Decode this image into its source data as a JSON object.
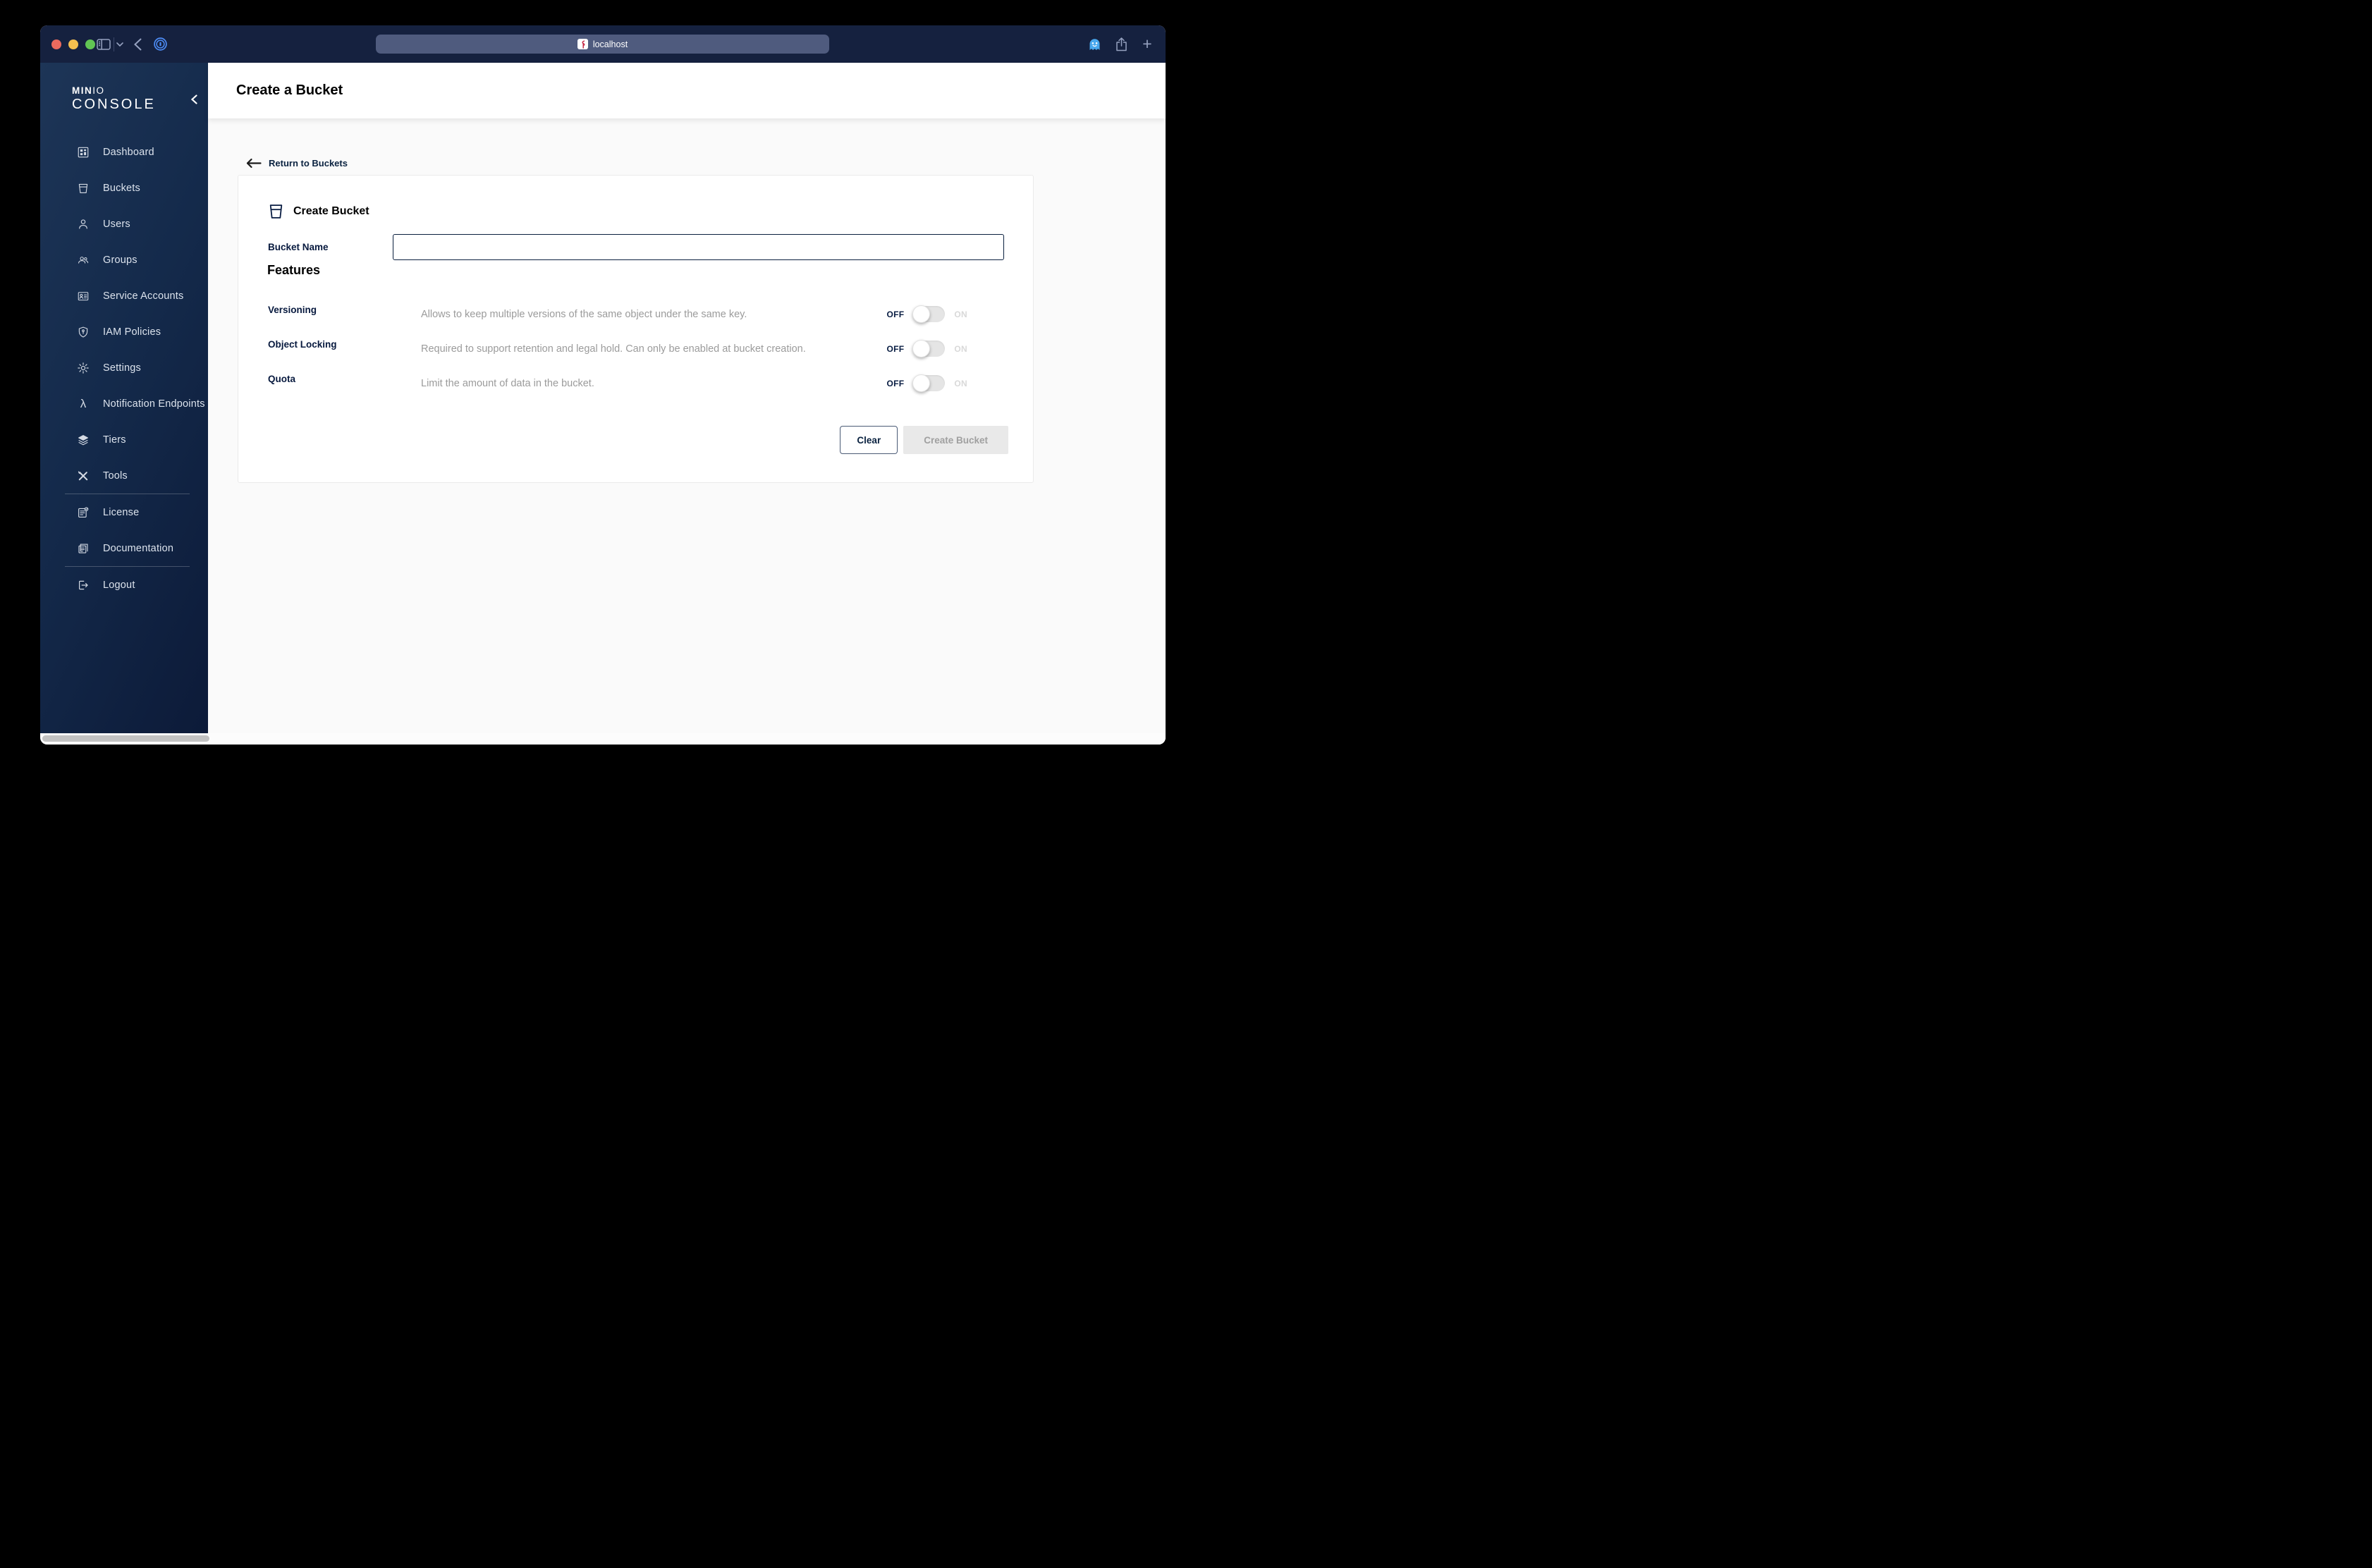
{
  "browser": {
    "url": "localhost",
    "icons": [
      "sidebar-toggle-icon",
      "chevron-down-icon",
      "back-icon",
      "onepassword-icon",
      "ghostery-icon",
      "share-icon",
      "new-tab-icon"
    ]
  },
  "sidebar": {
    "logo": {
      "brand_min": "MIN",
      "brand_io": "IO",
      "console": "CONSOLE"
    },
    "collapse_icon": "chevron-left-icon",
    "items": [
      {
        "label": "Dashboard",
        "icon": "dashboard-icon"
      },
      {
        "label": "Buckets",
        "icon": "bucket-icon"
      },
      {
        "label": "Users",
        "icon": "user-icon"
      },
      {
        "label": "Groups",
        "icon": "group-icon"
      },
      {
        "label": "Service Accounts",
        "icon": "id-card-icon"
      },
      {
        "label": "IAM Policies",
        "icon": "shield-icon"
      },
      {
        "label": "Settings",
        "icon": "gear-icon"
      },
      {
        "label": "Notification Endpoints",
        "icon": "lambda-icon"
      },
      {
        "label": "Tiers",
        "icon": "layers-icon"
      },
      {
        "label": "Tools",
        "icon": "tools-icon"
      },
      {
        "label": "License",
        "icon": "license-icon"
      },
      {
        "label": "Documentation",
        "icon": "documentation-icon"
      },
      {
        "label": "Logout",
        "icon": "logout-icon"
      }
    ],
    "lambda_glyph": "λ"
  },
  "header": {
    "title": "Create a Bucket"
  },
  "main": {
    "return_link": "Return to Buckets",
    "card": {
      "title": "Create Bucket",
      "title_icon": "bucket-icon",
      "bucket_name_label": "Bucket Name",
      "bucket_name_value": "",
      "features_heading": "Features",
      "features": [
        {
          "label": "Versioning",
          "description": "Allows to keep multiple versions of the same object under the same key.",
          "state": "OFF",
          "off_label": "OFF",
          "on_label": "ON"
        },
        {
          "label": "Object Locking",
          "description": "Required to support retention and legal hold. Can only be enabled at bucket creation.",
          "state": "OFF",
          "off_label": "OFF",
          "on_label": "ON"
        },
        {
          "label": "Quota",
          "description": "Limit the amount of data in the bucket.",
          "state": "OFF",
          "off_label": "OFF",
          "on_label": "ON"
        }
      ],
      "clear_label": "Clear",
      "create_label": "Create Bucket"
    }
  },
  "colors": {
    "toolbar_bg": "#15213f",
    "addressbar_bg": "#4f5b7e",
    "sidebar_gradient_start": "#1d3557",
    "sidebar_gradient_end": "#0c1a38",
    "traffic_red": "#ec6a5e",
    "traffic_yellow": "#f4bf4f",
    "traffic_green": "#61c554",
    "navy_text": "#07193E",
    "desc_gray": "#9b9b9b",
    "toggle_track": "#e5e5e5",
    "disabled_btn_bg": "#e9e9e9",
    "disabled_btn_text": "#a0a0a0"
  }
}
